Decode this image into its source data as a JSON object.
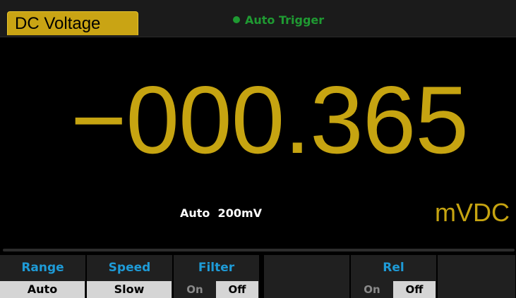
{
  "header": {
    "mode": "DC Voltage",
    "trigger_label": "Auto Trigger",
    "trigger_dot_color": "#1f9a32",
    "tab_color": "#c9a414"
  },
  "display": {
    "reading": "−000.365",
    "range_text": "Auto  200mV",
    "unit": "mVDC",
    "reading_color": "#c6a411"
  },
  "softkeys": [
    {
      "title": "Range",
      "value": "Auto"
    },
    {
      "title": "Speed",
      "value": "Slow"
    },
    {
      "title": "Filter",
      "options": [
        "On",
        "Off"
      ],
      "selected": "Off"
    },
    {
      "title": "",
      "value": ""
    },
    {
      "title": "Rel",
      "options": [
        "On",
        "Off"
      ],
      "selected": "Off"
    },
    {
      "title": "",
      "value": ""
    }
  ],
  "colors": {
    "softkey_title": "#1e9bd7",
    "softkey_bg": "#202020",
    "value_bg": "#d5d5d5"
  }
}
